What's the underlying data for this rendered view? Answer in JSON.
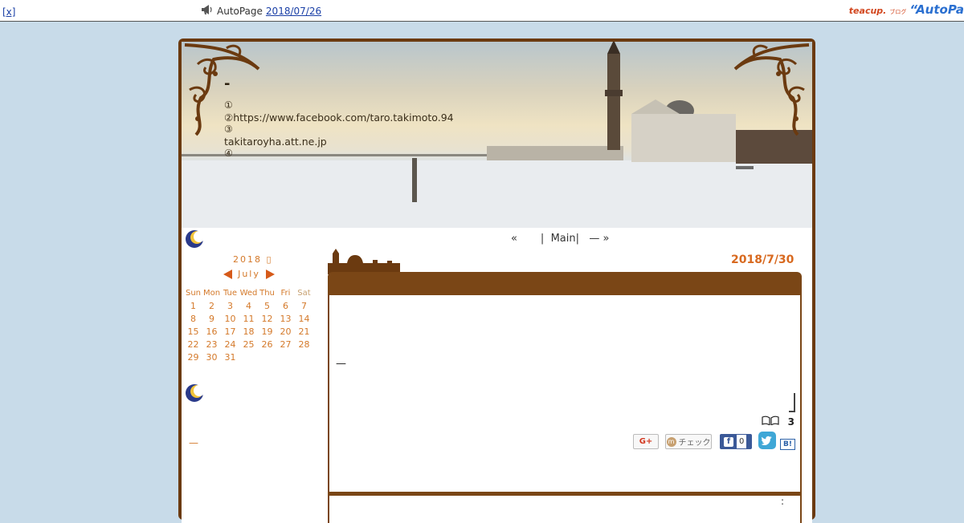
{
  "topbar": {
    "close_label": "[x]",
    "autopage_label": "AutoPage",
    "autopage_date": "2018/07/26",
    "brand_teacup": "teacup.",
    "brand_blog": "ブログ",
    "brand_autopage": "“AutoPa"
  },
  "header": {
    "title": "-",
    "lines": [
      "①",
      "②https://www.facebook.com/taro.takimoto.94",
      "③",
      "takitaroyha.att.ne.jp",
      "④"
    ]
  },
  "nav": {
    "prev": "«",
    "sep1": "|",
    "main": "Main",
    "sep2": "|",
    "next": "— »"
  },
  "calendar": {
    "year_label": "2018",
    "month_label": "July",
    "weekdays": [
      "Sun",
      "Mon",
      "Tue",
      "Wed",
      "Thu",
      "Fri",
      "Sat"
    ],
    "weeks": [
      [
        "1",
        "2",
        "3",
        "4",
        "5",
        "6",
        "7"
      ],
      [
        "8",
        "9",
        "10",
        "11",
        "12",
        "13",
        "14"
      ],
      [
        "15",
        "16",
        "17",
        "18",
        "19",
        "20",
        "21"
      ],
      [
        "22",
        "23",
        "24",
        "25",
        "26",
        "27",
        "28"
      ],
      [
        "29",
        "30",
        "31",
        "",
        "",
        "",
        ""
      ]
    ]
  },
  "sidebar": {
    "dash": "—"
  },
  "entry": {
    "date": "2018/7/30",
    "body_dash": "—",
    "count": "3",
    "share": {
      "check_label": "チェック",
      "facebook_count": "0",
      "hatena_label": "B!",
      "gplus_label": "G+"
    },
    "next_colon": ":"
  },
  "colors": {
    "page_bg": "#c8dbe9",
    "frame_brown": "#7a4616",
    "accent_orange": "#d4792a",
    "date_orange": "#d8691f",
    "link_blue": "#1a3fa6"
  }
}
